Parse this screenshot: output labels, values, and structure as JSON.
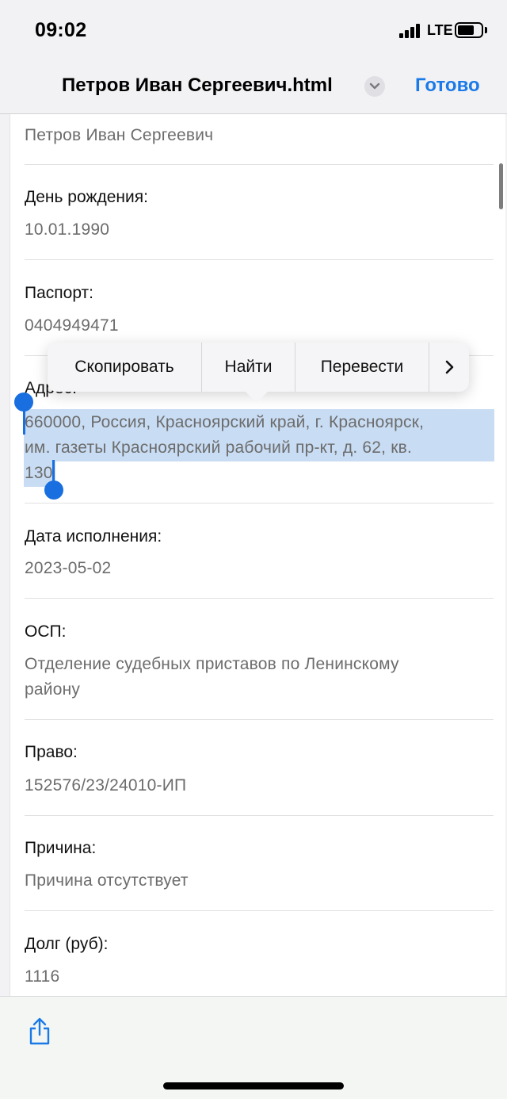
{
  "status_bar": {
    "time": "09:02",
    "network": "LTE"
  },
  "nav": {
    "title": "Петров Иван Сергеевич.html",
    "done_label": "Готово"
  },
  "document": {
    "name_value": "Петров Иван Сергеевич",
    "fields": [
      {
        "label": "День рождения:",
        "value": "10.01.1990"
      },
      {
        "label": "Паспорт:",
        "value": "0404949471"
      },
      {
        "label": "Адрес:",
        "value_line1": "660000, Россия, Красноярский край, г. Красноярск,",
        "value_line2": "им. газеты Красноярский рабочий пр-кт, д. 62, кв.",
        "value_line3": "130"
      },
      {
        "label": "Дата исполнения:",
        "value": "2023-05-02"
      },
      {
        "label": "ОСП:",
        "value_line1": "Отделение судебных приставов по Ленинскому",
        "value_line2": "району"
      },
      {
        "label": "Право:",
        "value": "152576/23/24010-ИП"
      },
      {
        "label": "Причина:",
        "value": "Причина отсутствует"
      },
      {
        "label": "Долг (руб):",
        "value": "1116"
      }
    ]
  },
  "context_menu": {
    "items": [
      "Скопировать",
      "Найти",
      "Перевести"
    ],
    "more_icon": "chevron-right-icon"
  },
  "toolbar": {
    "share_icon": "share-icon"
  },
  "colors": {
    "accent": "#1a7ae8",
    "selection": "#c8dcf3",
    "handle": "#1a6fe0"
  }
}
